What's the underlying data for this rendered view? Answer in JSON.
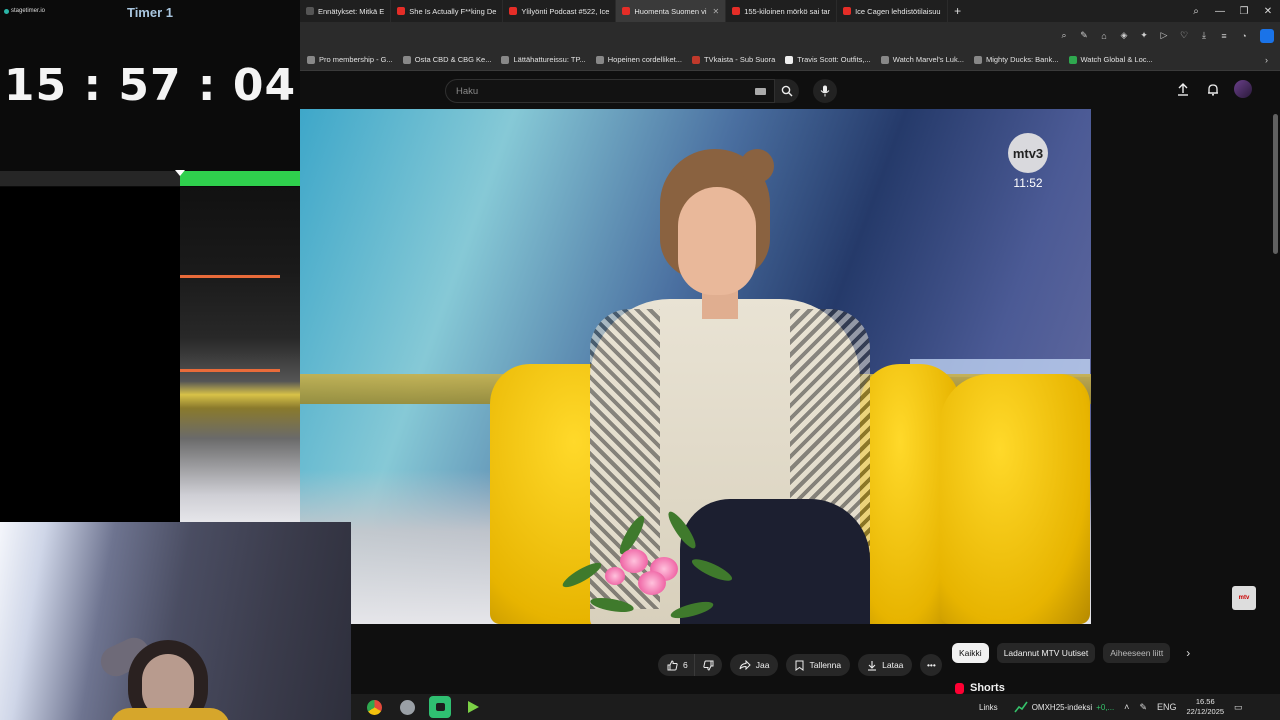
{
  "stagetimer": {
    "brand": "stagetimer.io",
    "title": "Timer 1",
    "time": "15:57:04",
    "progress_fraction_remaining": 0.4,
    "colors": {
      "fill": "#2fd04d",
      "title": "#a9c6df"
    }
  },
  "browser": {
    "tabs": [
      {
        "label": "Ennätykset: Mitkä E",
        "icon": "site-icon"
      },
      {
        "label": "She Is Actually F**king De",
        "icon": "youtube-icon"
      },
      {
        "label": "Ylilyönti Podcast #522, Ice",
        "icon": "youtube-icon"
      },
      {
        "label": "Huomenta Suomen vi",
        "icon": "youtube-icon",
        "active": true
      },
      {
        "label": "155-kiloinen mörkö sai tar",
        "icon": "news-icon"
      },
      {
        "label": "Ice Cagen lehdistötilaisuu",
        "icon": "news-icon"
      }
    ],
    "new_tab": "+",
    "window_controls": [
      "search",
      "minimize",
      "restore",
      "close"
    ],
    "bookmarks": [
      "Pro membership - G...",
      "Osta CBD & CBG Ke...",
      "Lättähattureissu: TP...",
      "Hopeinen cordelliket...",
      "TVkaista - Sub Suora",
      "Travis Scott: Outfits,...",
      "Watch Marvel's Luk...",
      "Mighty Ducks: Bank...",
      "Watch Global & Loc..."
    ],
    "bookmarks_more": "›"
  },
  "youtube": {
    "search_placeholder": "Haku",
    "video": {
      "channel_logo": "mtv3",
      "clock": "11:52",
      "corner_logo": "mtv"
    },
    "actions": {
      "likes": "6",
      "share": "Jaa",
      "save": "Tallenna",
      "download": "Lataa",
      "more": "•••"
    },
    "chips": [
      "Kaikki",
      "Ladannut MTV Uutiset",
      "Aiheeseen liitt"
    ],
    "shorts_label": "Shorts",
    "accent": "#ff0033"
  },
  "taskbar": {
    "apps": [
      "chrome-icon",
      "settings-icon",
      "messages-icon",
      "media-player-icon"
    ],
    "links": "Links",
    "stock_name": "OMXH25-indeksi",
    "stock_change": "+0,...",
    "language": "ENG",
    "time": "16.56",
    "date": "22/12/2025"
  }
}
